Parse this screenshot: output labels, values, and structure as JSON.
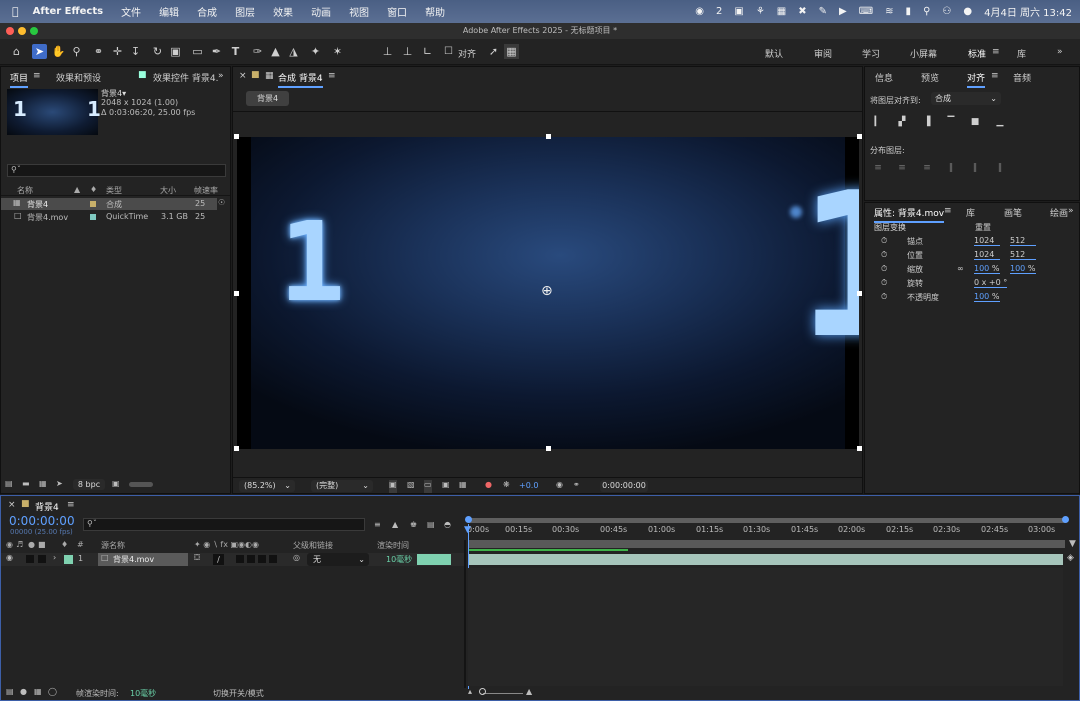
{
  "menubar": {
    "app": "After Effects",
    "items": [
      "文件",
      "编辑",
      "合成",
      "图层",
      "效果",
      "动画",
      "视图",
      "窗口",
      "帮助"
    ],
    "status_badge": "2",
    "datetime": "4月4日 周六 13:42"
  },
  "titlebar": {
    "title": "Adobe After Effects 2025 - 无标题项目 *"
  },
  "toolbar": {
    "align_label": "对齐",
    "workspaces": [
      "默认",
      "审阅",
      "学习",
      "小屏幕",
      "标准",
      "库"
    ],
    "active_workspace": "标准"
  },
  "project": {
    "tab_project": "项目",
    "tab_effects": "效果和预设",
    "tab_effect_controls": "效果控件 背景4.",
    "preview": {
      "name": "背景4▾",
      "dims": "2048 x 1024 (1.00)",
      "duration": "Δ 0:03:06:20, 25.00 fps",
      "thumb_text": "1"
    },
    "search_placeholder": "",
    "columns": {
      "name": "名称",
      "type": "类型",
      "size": "大小",
      "fps": "帧速率"
    },
    "items": [
      {
        "name": "背景4",
        "type": "合成",
        "size": "",
        "fps": "25",
        "color": "#c8b06a"
      },
      {
        "name": "背景4.mov",
        "type": "QuickTime",
        "size": "3.1 GB",
        "fps": "25",
        "color": "#7fc9c0"
      }
    ],
    "bpc": "8 bpc"
  },
  "comp": {
    "tab_label": "合成 背景4",
    "flow_button": "背景4",
    "zoom": "(85.2%)",
    "quality": "(完整)",
    "exposure": "+0.0",
    "timecode": "0:00:00:00",
    "digit_left": "1",
    "digit_right": "1"
  },
  "align": {
    "tabs": [
      "信息",
      "预览",
      "对齐",
      "音频"
    ],
    "active_tab": "对齐",
    "align_to_label": "将图层对齐到:",
    "align_to_value": "合成",
    "distribute_label": "分布图层:"
  },
  "properties": {
    "tab_label": "属性: 背景4.mov",
    "tab_library": "库",
    "tab_brush": "画笔",
    "tab_paint": "绘画",
    "section": "图层变换",
    "reset": "重置",
    "rows": [
      {
        "label": "锚点",
        "v1": "1024",
        "v2": "512"
      },
      {
        "label": "位置",
        "v1": "1024",
        "v2": "512"
      },
      {
        "label": "缩放",
        "v1": "100",
        "v2": "100",
        "unit": "%"
      },
      {
        "label": "旋转",
        "v1": "0 x +0 °",
        "v2": ""
      },
      {
        "label": "不透明度",
        "v1": "100",
        "v2": "",
        "unit": "%"
      }
    ]
  },
  "timeline": {
    "tab_label": "背景4",
    "timecode": "0:00:00:00",
    "fps": "00000 (25.00 fps)",
    "columns": {
      "num": "#",
      "source": "源名称",
      "parent": "父级和链接",
      "render": "渲染时间"
    },
    "layer": {
      "num": "1",
      "name": "背景4.mov",
      "parent": "无",
      "render": "10毫秒"
    },
    "ruler": [
      "0:00s",
      "00:15s",
      "00:30s",
      "00:45s",
      "01:00s",
      "01:15s",
      "01:30s",
      "01:45s",
      "02:00s",
      "02:15s",
      "02:30s",
      "02:45s",
      "03:00s"
    ],
    "footer_render_label": "帧渲染时间:",
    "footer_render_value": "10毫秒",
    "footer_switch": "切换开关/模式"
  },
  "colors": {
    "accent": "#5fa0ff",
    "menubar": "#52668b",
    "layer_green": "#7fd1b0"
  }
}
